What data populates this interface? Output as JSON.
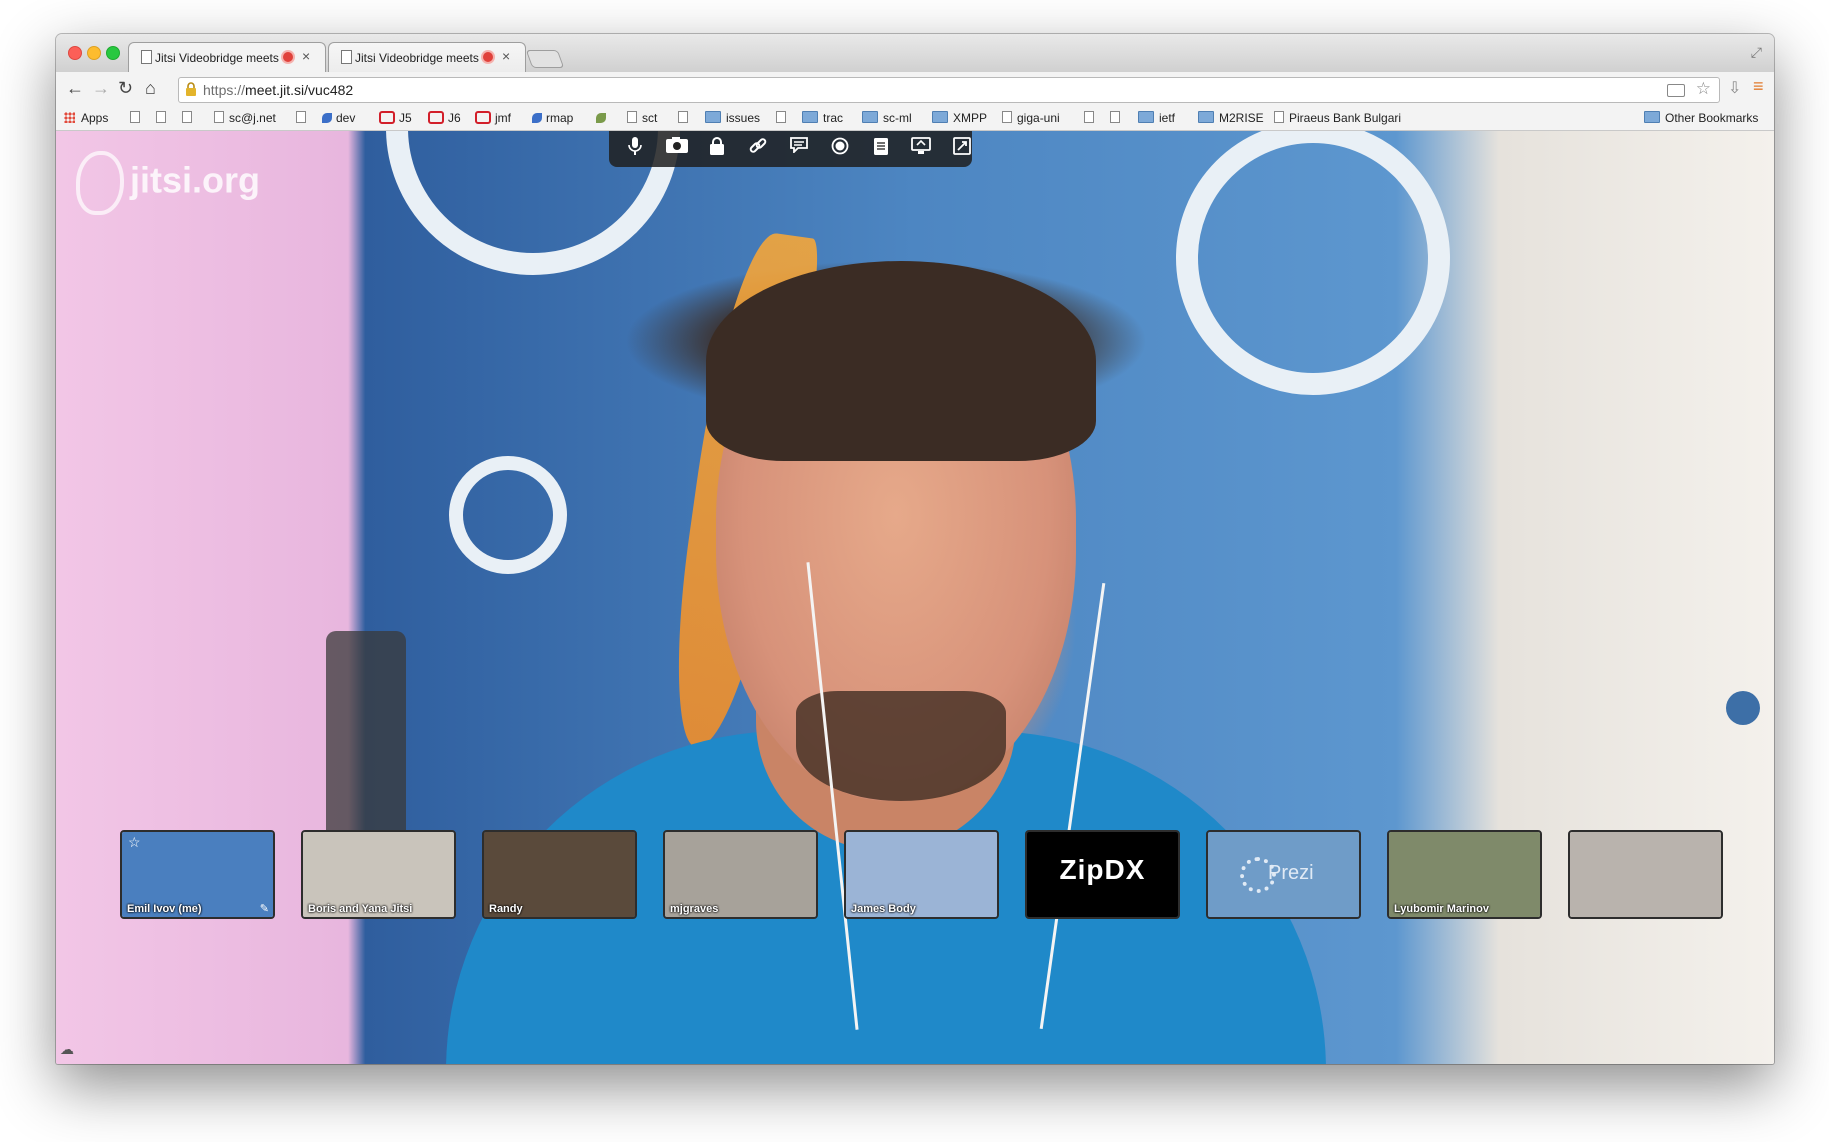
{
  "tabs": [
    {
      "title": "Jitsi Videobridge meets",
      "close": "×"
    },
    {
      "title": "Jitsi Videobridge meets",
      "close": "×"
    }
  ],
  "toolbar": {
    "url_scheme": "https://",
    "url_host": "meet.jit.si",
    "url_path": "/vuc482"
  },
  "bookmarks": {
    "apps": "Apps",
    "items": [
      "sc@j.net",
      "dev",
      "J5",
      "J6",
      "jmf",
      "rmap",
      "sct",
      "issues",
      "trac",
      "sc-ml",
      "XMPP",
      "giga-uni",
      "ietf",
      "M2RISE",
      "Piraeus Bank Bulgari"
    ],
    "other": "Other Bookmarks"
  },
  "stage": {
    "watermark": "jitsi.org"
  },
  "controls": [
    "microphone-icon",
    "camera-icon",
    "lock-icon",
    "link-icon",
    "chat-icon",
    "record-icon",
    "etherpad-icon",
    "desktop-share-icon",
    "fullscreen-icon"
  ],
  "participants": [
    {
      "name": "Emil Ivov (me)",
      "bg": "#4a7fbf"
    },
    {
      "name": "Boris and Yana Jitsi",
      "bg": "#c9c4bb"
    },
    {
      "name": "Randy",
      "bg": "#5a4a3b"
    },
    {
      "name": "mjgraves",
      "bg": "#a7a29a"
    },
    {
      "name": "James Body",
      "bg": "#9bb4d6"
    },
    {
      "name": "",
      "bg": "#000000",
      "logo": "ZipDX"
    },
    {
      "name": "",
      "bg": "#6f9cc8",
      "logo": "Prezi"
    },
    {
      "name": "Lyubomir Marinov",
      "bg": "#7f8a6a"
    },
    {
      "name": "",
      "bg": "#b9b3ad"
    }
  ]
}
